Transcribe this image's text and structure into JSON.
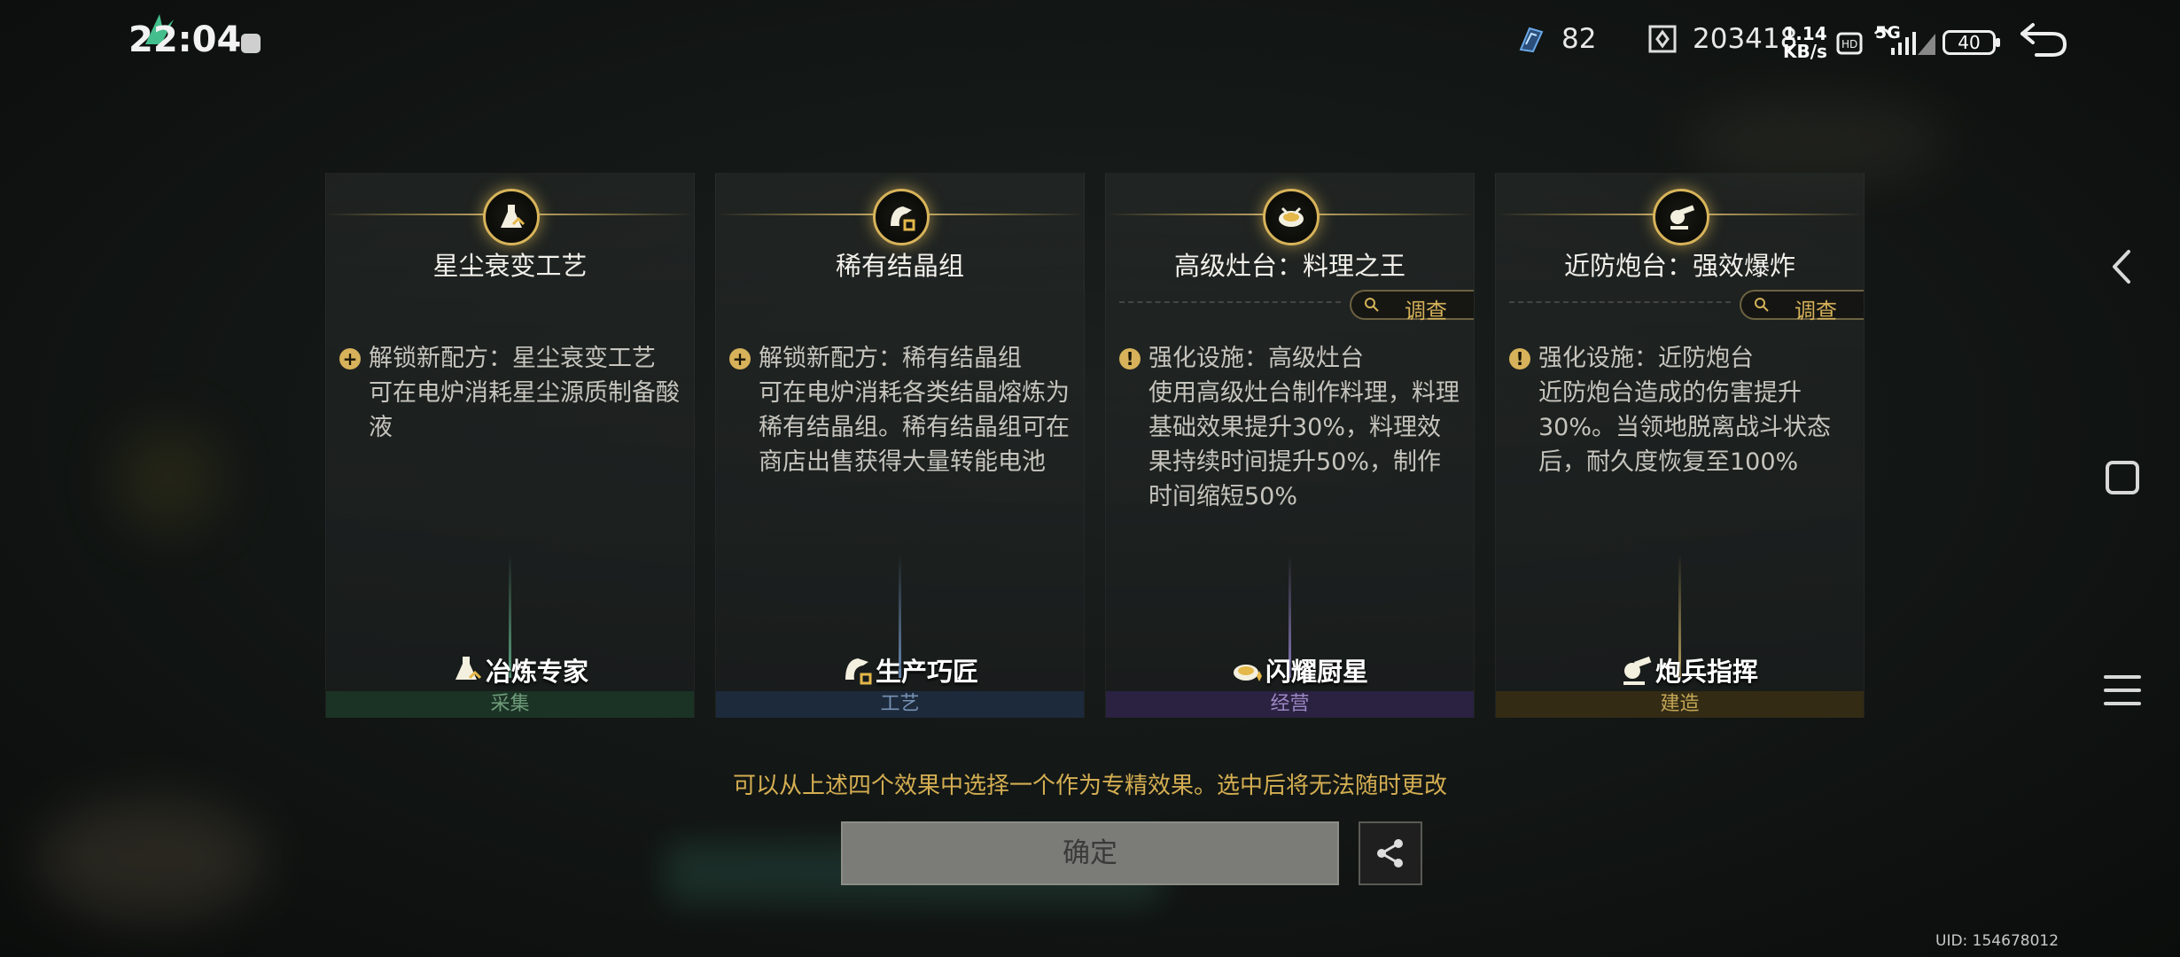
{
  "status_bar": {
    "time": "22:04",
    "energy": "82",
    "coins": "203418",
    "net_speed_line1": "1.14",
    "net_speed_line2": "KB/s",
    "network": "5G",
    "battery": "40"
  },
  "cards": [
    {
      "title": "星尘衰变工艺",
      "description": "解锁新配方：星尘衰变工艺\n可在电炉消耗星尘源质制备酸液",
      "bullet_type": "plus",
      "has_investigate": false,
      "badge_name": "冶炼专家",
      "category": "采集",
      "category_color": "#6f9b7a",
      "footer_bg": "#1b3325",
      "beam_color": "#6fc79d"
    },
    {
      "title": "稀有结晶组",
      "description": "解锁新配方：稀有结晶组\n可在电炉消耗各类结晶熔炼为稀有结晶组。稀有结晶组可在商店出售获得大量转能电池",
      "bullet_type": "plus",
      "has_investigate": false,
      "badge_name": "生产巧匠",
      "category": "工艺",
      "category_color": "#7792b5",
      "footer_bg": "#1d2a3c",
      "beam_color": "#7fa6d9"
    },
    {
      "title": "高级灶台：料理之王",
      "description": "强化设施：高级灶台\n使用高级灶台制作料理，料理基础效果提升30%，料理效果持续时间提升50%，制作时间缩短50%",
      "bullet_type": "up",
      "has_investigate": true,
      "investigate_label": "调查",
      "badge_name": "闪耀厨星",
      "category": "经营",
      "category_color": "#9c86c4",
      "footer_bg": "#2a2240",
      "beam_color": "#a994e6"
    },
    {
      "title": "近防炮台：强效爆炸",
      "description": "强化设施：近防炮台\n近防炮台造成的伤害提升30%。当领地脱离战斗状态后，耐久度恢复至100%",
      "bullet_type": "up",
      "has_investigate": true,
      "investigate_label": "调查",
      "badge_name": "炮兵指挥",
      "category": "建造",
      "category_color": "#c4a656",
      "footer_bg": "#332b14",
      "beam_color": "#e2c470"
    }
  ],
  "hint": "可以从上述四个效果中选择一个作为专精效果。选中后将无法随时更改",
  "confirm_label": "确定",
  "uid": "UID: 154678012",
  "colors": {
    "gold": "#d4ae52",
    "confirm_bg": "#7b7b77"
  }
}
